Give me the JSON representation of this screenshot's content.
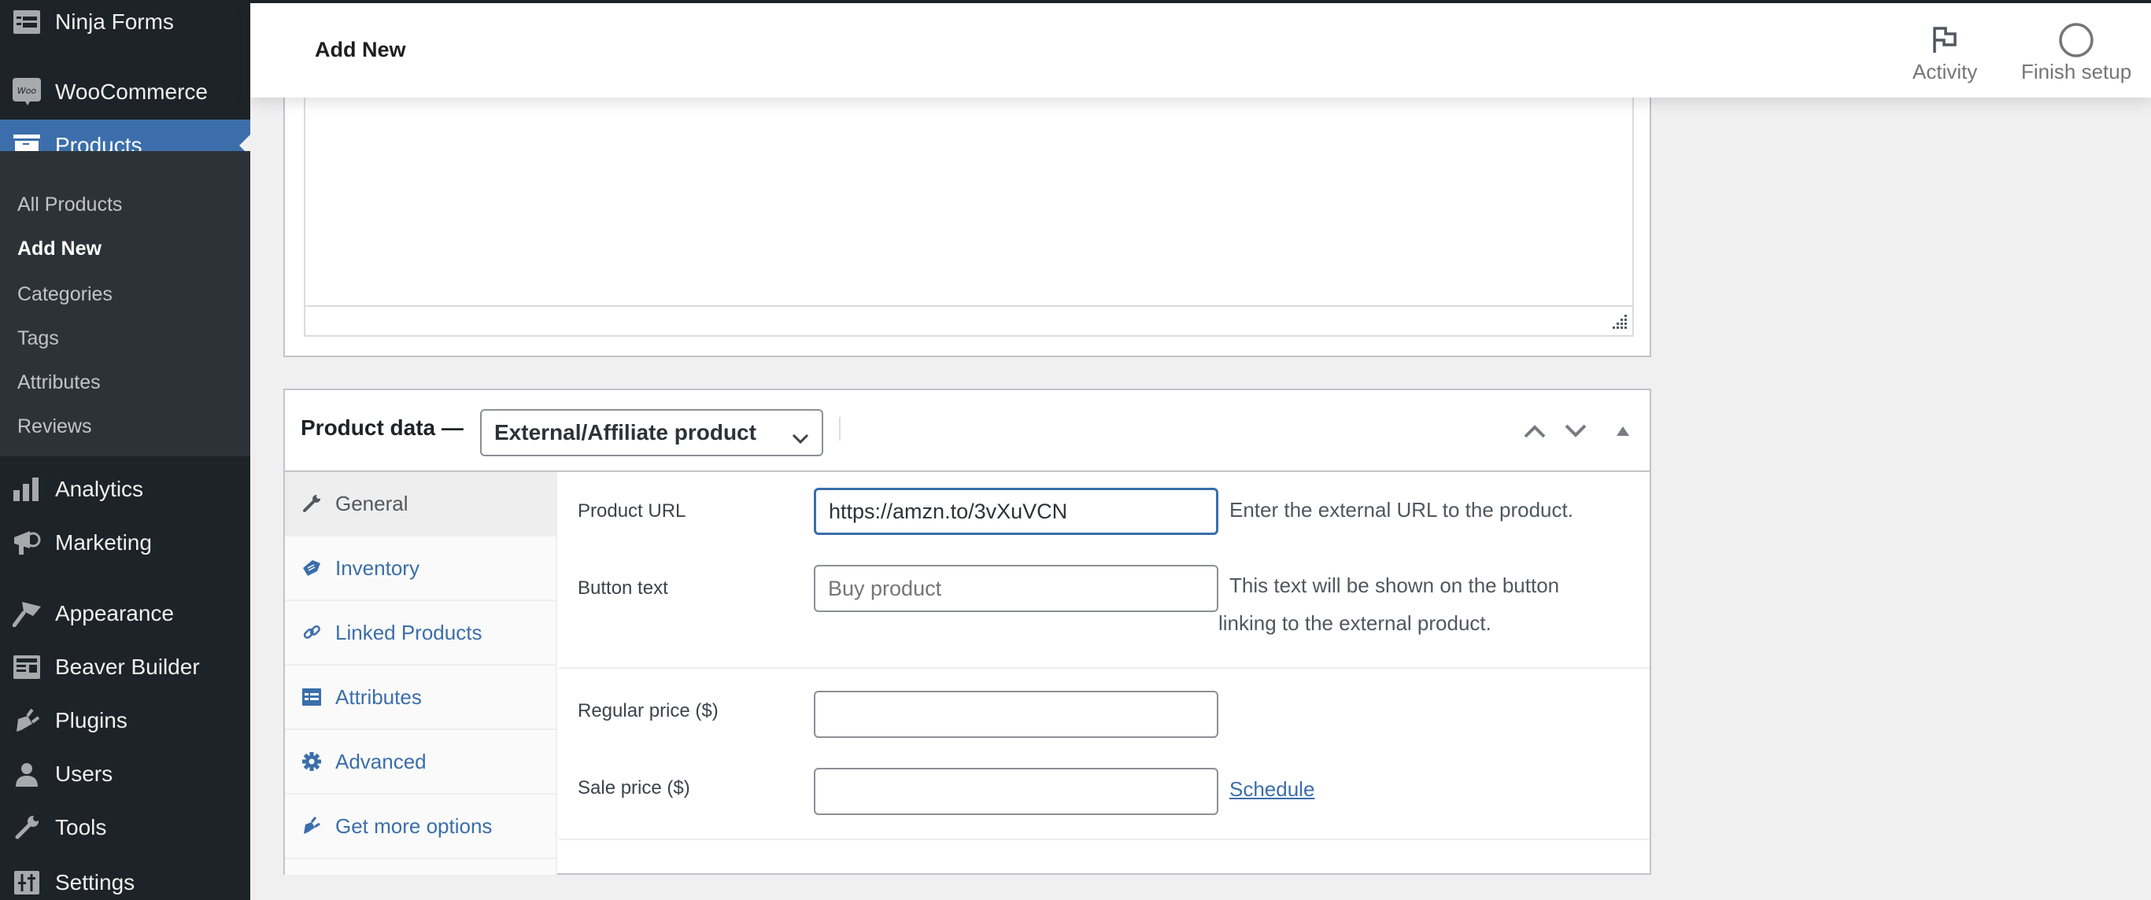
{
  "sidebar": {
    "items": [
      {
        "label": "Ninja Forms",
        "icon": "ninja-forms-icon"
      },
      {
        "label": "WooCommerce",
        "icon": "woocommerce-icon"
      },
      {
        "label": "Products",
        "icon": "products-icon",
        "active": true
      },
      {
        "label": "Analytics",
        "icon": "analytics-icon"
      },
      {
        "label": "Marketing",
        "icon": "megaphone-icon"
      },
      {
        "label": "Appearance",
        "icon": "paintbrush-icon"
      },
      {
        "label": "Beaver Builder",
        "icon": "beaver-builder-icon"
      },
      {
        "label": "Plugins",
        "icon": "plug-icon"
      },
      {
        "label": "Users",
        "icon": "user-icon"
      },
      {
        "label": "Tools",
        "icon": "wrench-icon"
      },
      {
        "label": "Settings",
        "icon": "settings-sliders-icon"
      }
    ],
    "submenu": [
      {
        "label": "All Products"
      },
      {
        "label": "Add New",
        "current": true
      },
      {
        "label": "Categories"
      },
      {
        "label": "Tags"
      },
      {
        "label": "Attributes"
      },
      {
        "label": "Reviews"
      }
    ]
  },
  "header": {
    "title": "Add New",
    "activity_label": "Activity",
    "finish_setup_label": "Finish setup"
  },
  "product_data": {
    "title": "Product data —",
    "product_type": "External/Affiliate product",
    "tabs": [
      {
        "label": "General",
        "icon": "wrench-icon",
        "active": true
      },
      {
        "label": "Inventory",
        "icon": "tag-icon"
      },
      {
        "label": "Linked Products",
        "icon": "link-icon"
      },
      {
        "label": "Attributes",
        "icon": "list-icon"
      },
      {
        "label": "Advanced",
        "icon": "gear-icon"
      },
      {
        "label": "Get more options",
        "icon": "plug-icon"
      }
    ],
    "fields": {
      "product_url": {
        "label": "Product URL",
        "value": "https://amzn.to/3vXuVCN",
        "description": "Enter the external URL to the product."
      },
      "button_text": {
        "label": "Button text",
        "placeholder": "Buy product",
        "description_line1": "This text will be shown on the button",
        "description_line2": "linking to the external product."
      },
      "regular_price": {
        "label": "Regular price ($)",
        "value": ""
      },
      "sale_price": {
        "label": "Sale price ($)",
        "value": "",
        "schedule_link": "Schedule"
      }
    }
  },
  "colors": {
    "sidebar_bg": "#1d2327",
    "submenu_bg": "#2c3338",
    "accent": "#3b6eaa",
    "page_bg": "#f0f0f1"
  }
}
